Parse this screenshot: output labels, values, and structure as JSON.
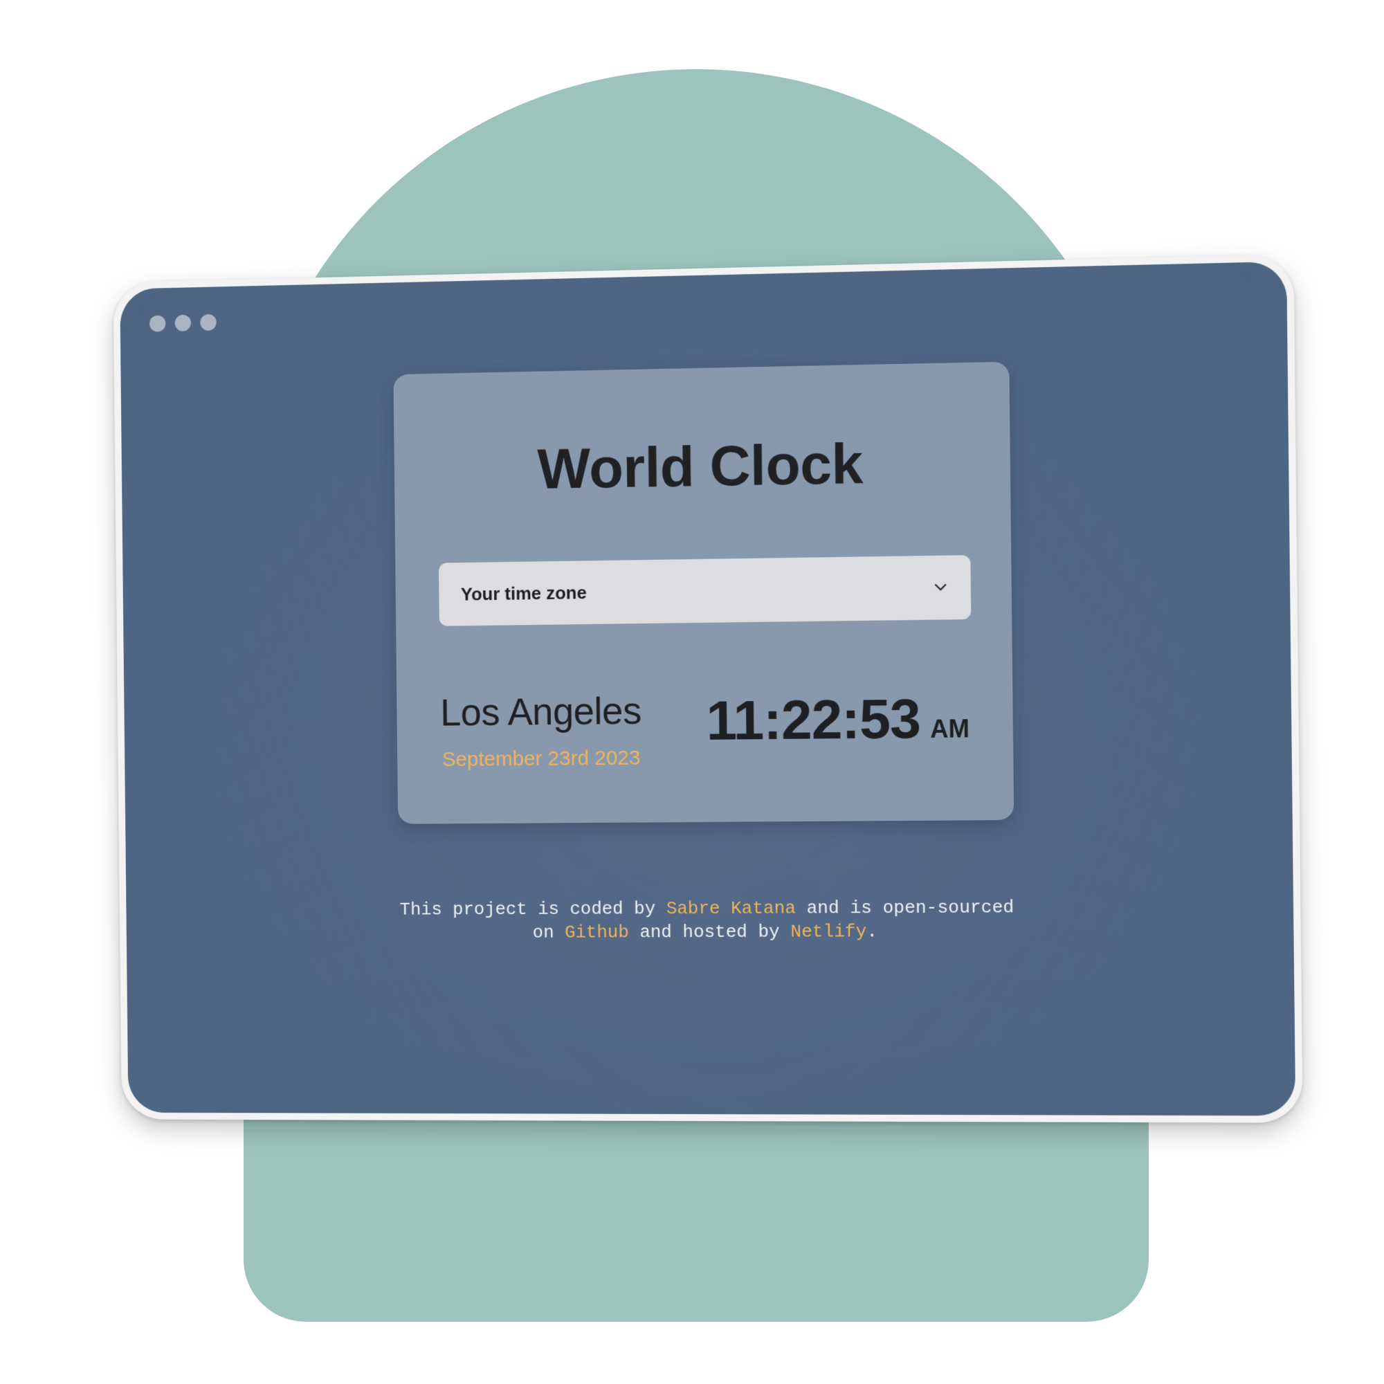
{
  "window": {
    "traffic_lights": [
      "dot",
      "dot",
      "dot"
    ]
  },
  "card": {
    "title": "World Clock",
    "timezone_select": {
      "selected": "Your time zone",
      "icon": "chevron-down-icon"
    },
    "city": {
      "name": "Los Angeles",
      "date": "September 23rd 2023",
      "time": "11:22:53",
      "ampm": "AM"
    }
  },
  "footer": {
    "text_1": "This project is coded by ",
    "author_link": "Sabre Katana",
    "text_2": " and is open-sourced on ",
    "github_link": "Github",
    "text_3": " and hosted by ",
    "netlify_link": "Netlify",
    "text_4": "."
  },
  "colors": {
    "backdrop": "#9cc4bc",
    "screen": "#4f6684",
    "card": "#8899ae",
    "accent": "#f0b35c",
    "select": "#dcdde0"
  }
}
